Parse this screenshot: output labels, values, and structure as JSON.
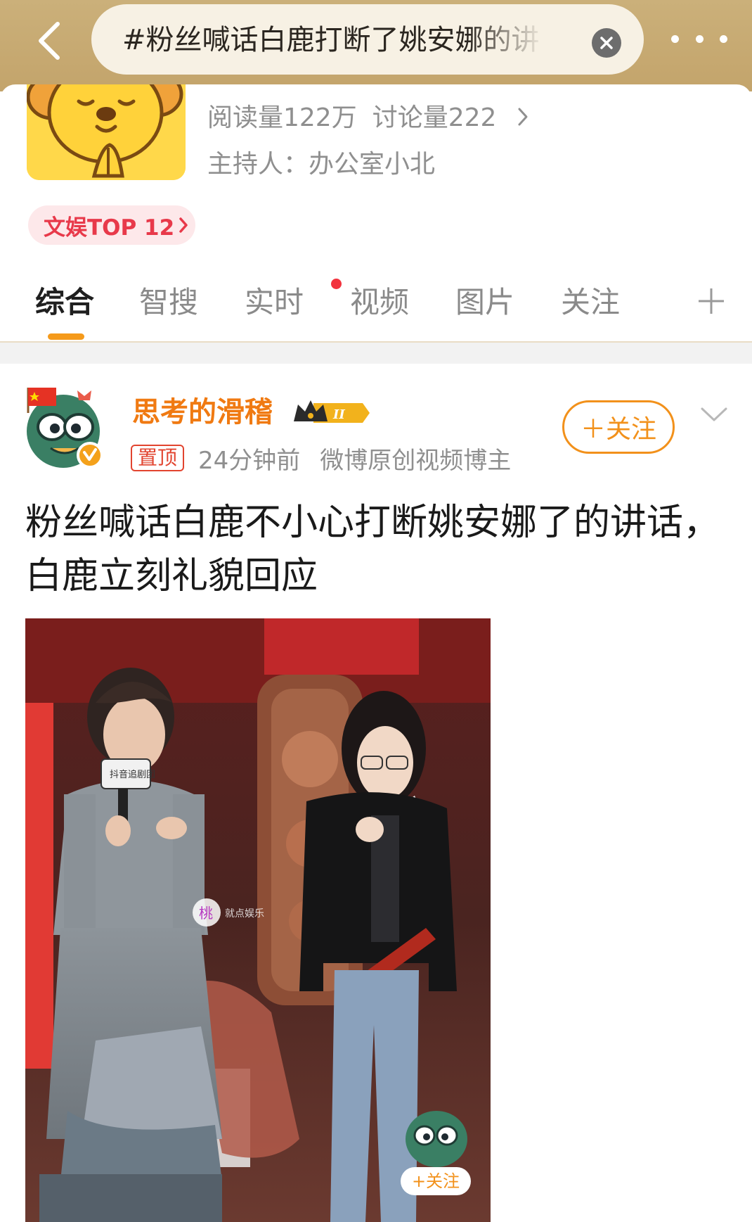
{
  "top_bar": {
    "search_text": "#粉丝喊话白鹿打断了姚安娜的讲",
    "background": "#c6a96f"
  },
  "topic": {
    "stats": {
      "reads": "阅读量122万",
      "discussions": "讨论量222"
    },
    "host": "主持人：办公室小北",
    "rank_badge": "文娱TOP 12"
  },
  "tabs": [
    {
      "label": "综合",
      "active": true
    },
    {
      "label": "智搜"
    },
    {
      "label": "实时",
      "dot": true
    },
    {
      "label": "视频"
    },
    {
      "label": "图片"
    },
    {
      "label": "关注"
    }
  ],
  "post": {
    "username": "思考的滑稽",
    "pin_label": "置顶",
    "time": "24分钟前",
    "role": "微博原创视频博主",
    "follow_label": "＋关注",
    "title": "粉丝喊话白鹿不小心打断姚安娜了的讲话，白鹿立刻礼貌回应",
    "media": {
      "mic_logo": "抖音追剧团",
      "watermark": "桃",
      "watermark_text": "就点娱乐",
      "overlay_follow": "+关注"
    }
  },
  "colors": {
    "accent": "#f2911b",
    "username": "#f07a12",
    "rank_text": "#e8394a",
    "red_dot": "#f2333e"
  },
  "icons": [
    "back-arrow-icon",
    "clear-icon",
    "more-dots-icon",
    "chevron-right-icon",
    "plus-icon",
    "crown-icon",
    "chevron-down-icon"
  ]
}
